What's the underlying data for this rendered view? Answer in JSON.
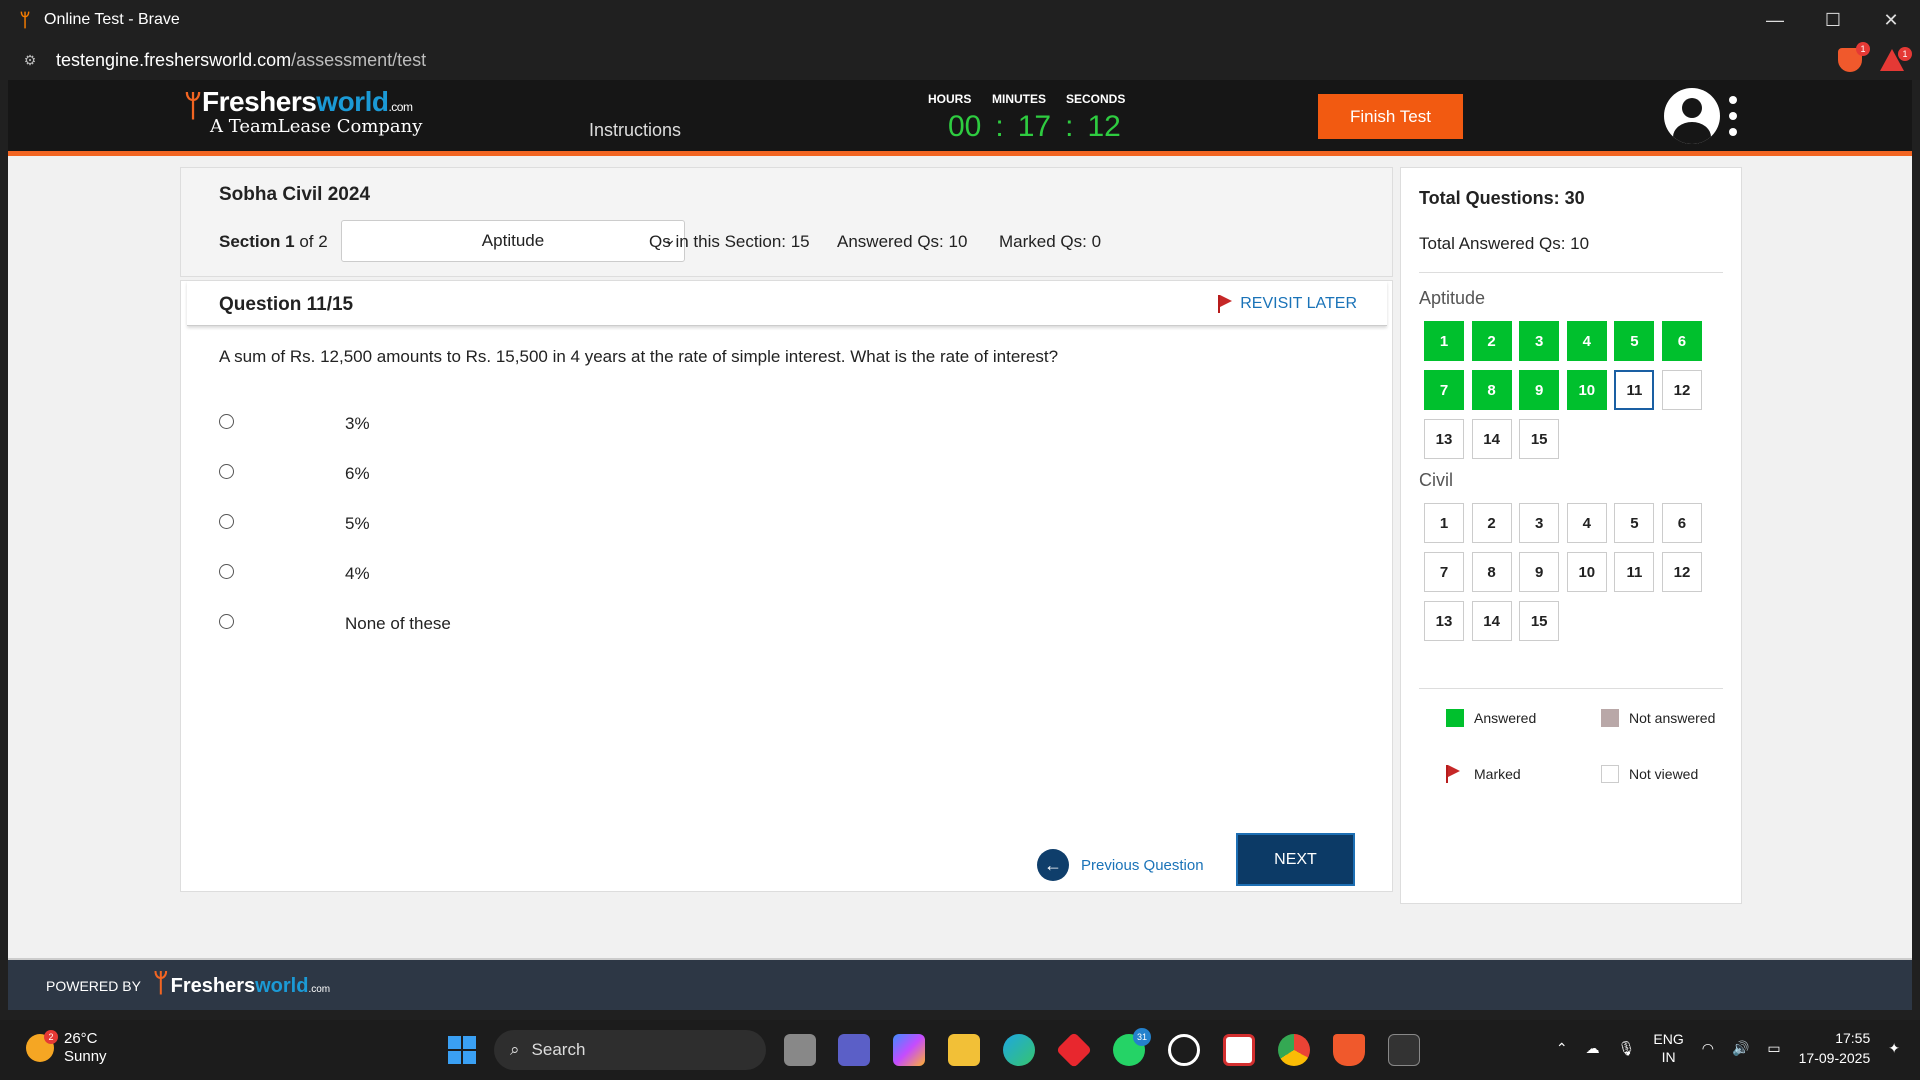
{
  "browser": {
    "window_title": "Online Test - Brave",
    "url_host": "testengine.freshersworld.com",
    "url_path": "/assessment/test",
    "shield_badge": "1",
    "rewards_badge": "1"
  },
  "header": {
    "logo_name": "Freshers",
    "logo_world": "world",
    "logo_com": ".com",
    "logo_tagline": "A TeamLease Company",
    "instructions_link": "Instructions",
    "finish_button": "Finish Test"
  },
  "timer": {
    "hours_label": "HOURS",
    "minutes_label": "MINUTES",
    "seconds_label": "SECONDS",
    "hours": "00",
    "minutes": "17",
    "seconds": "12",
    "separator": ":"
  },
  "test_info": {
    "test_name": "Sobha Civil 2024",
    "section_prefix": "Section 1",
    "section_of": " of 2",
    "section_selected": "Aptitude",
    "qs_in_section": "Qs in this Section: 15",
    "answered_qs": "Answered Qs: 10",
    "marked_qs": "Marked Qs: 0"
  },
  "question": {
    "number_label": "Question 11/15",
    "revisit_label": "REVISIT LATER",
    "text": "A sum of Rs. 12,500 amounts to Rs. 15,500 in 4 years at the rate of simple interest. What is the rate of interest?",
    "options": [
      "3%",
      "6%",
      "5%",
      "4%",
      "None of these"
    ],
    "prev_label": "Previous Question",
    "next_label": "NEXT"
  },
  "palette": {
    "total_questions": "Total Questions: 30",
    "total_answered": "Total Answered Qs: 10",
    "sections": [
      {
        "name": "Aptitude",
        "questions": [
          {
            "n": "1",
            "state": "answered"
          },
          {
            "n": "2",
            "state": "answered"
          },
          {
            "n": "3",
            "state": "answered"
          },
          {
            "n": "4",
            "state": "answered"
          },
          {
            "n": "5",
            "state": "answered"
          },
          {
            "n": "6",
            "state": "answered"
          },
          {
            "n": "7",
            "state": "answered"
          },
          {
            "n": "8",
            "state": "answered"
          },
          {
            "n": "9",
            "state": "answered"
          },
          {
            "n": "10",
            "state": "answered"
          },
          {
            "n": "11",
            "state": "current"
          },
          {
            "n": "12",
            "state": "not-viewed"
          },
          {
            "n": "13",
            "state": "not-viewed"
          },
          {
            "n": "14",
            "state": "not-viewed"
          },
          {
            "n": "15",
            "state": "not-viewed"
          }
        ]
      },
      {
        "name": "Civil",
        "questions": [
          {
            "n": "1",
            "state": "not-viewed"
          },
          {
            "n": "2",
            "state": "not-viewed"
          },
          {
            "n": "3",
            "state": "not-viewed"
          },
          {
            "n": "4",
            "state": "not-viewed"
          },
          {
            "n": "5",
            "state": "not-viewed"
          },
          {
            "n": "6",
            "state": "not-viewed"
          },
          {
            "n": "7",
            "state": "not-viewed"
          },
          {
            "n": "8",
            "state": "not-viewed"
          },
          {
            "n": "9",
            "state": "not-viewed"
          },
          {
            "n": "10",
            "state": "not-viewed"
          },
          {
            "n": "11",
            "state": "not-viewed"
          },
          {
            "n": "12",
            "state": "not-viewed"
          },
          {
            "n": "13",
            "state": "not-viewed"
          },
          {
            "n": "14",
            "state": "not-viewed"
          },
          {
            "n": "15",
            "state": "not-viewed"
          }
        ]
      }
    ],
    "legend": {
      "answered": "Answered",
      "not_answered": "Not answered",
      "marked": "Marked",
      "not_viewed": "Not viewed"
    }
  },
  "footer": {
    "powered_by": "POWERED BY",
    "logo_name": "Freshers",
    "logo_world": "world",
    "logo_com": ".com"
  },
  "taskbar": {
    "weather_badge": "2",
    "temperature": "26°C",
    "condition": "Sunny",
    "search_label": "Search",
    "whatsapp_badge": "31",
    "lang_top": "ENG",
    "lang_bottom": "IN",
    "time": "17:55",
    "date": "17-09-2025"
  },
  "colors": {
    "accent_orange": "#f25a11",
    "answered_green": "#00c02d",
    "timer_green": "#2ecc40",
    "link_blue": "#1a73b8",
    "next_navy": "#0c3a66",
    "not_answered_gray": "#b9a8a8"
  }
}
